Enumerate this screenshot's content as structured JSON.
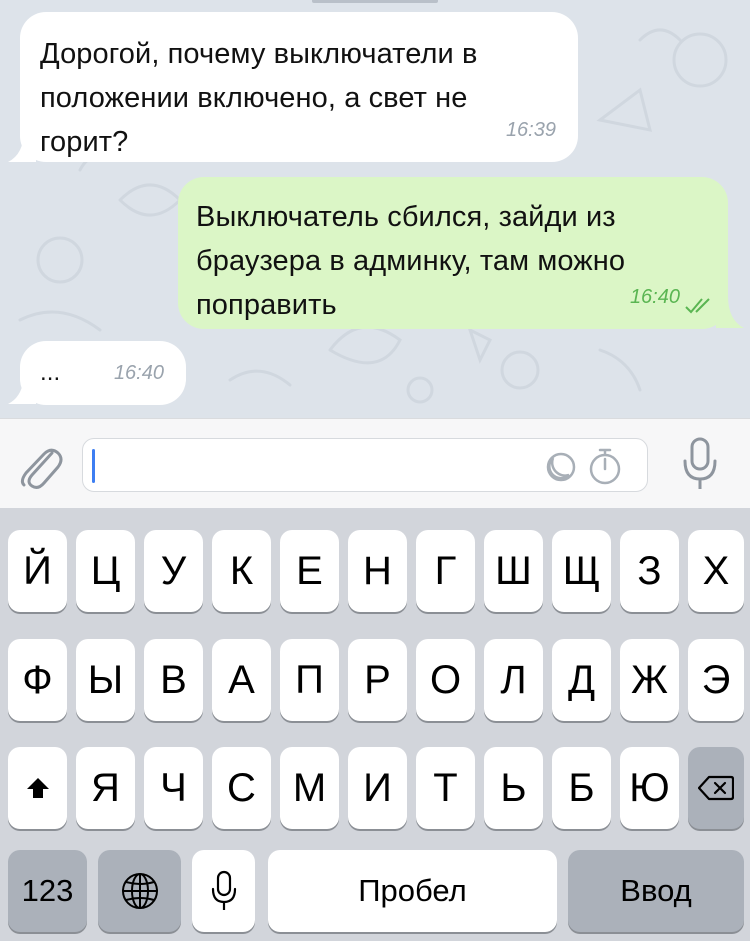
{
  "chat": {
    "messages": [
      {
        "direction": "incoming",
        "text": "Дорогой, почему выключатели в\nположении включено, а свет не\nгорит?",
        "time": "16:39"
      },
      {
        "direction": "outgoing",
        "text": "Выключатель сбился, зайди из\nбраузера в админку, там можно\nпоправить",
        "time": "16:40",
        "status": "read"
      },
      {
        "direction": "incoming",
        "text": "...",
        "time": "16:40"
      }
    ]
  },
  "input": {
    "value": "",
    "placeholder": ""
  },
  "icons": {
    "attach": "paperclip-icon",
    "stickers": "moon-icon",
    "timer": "stopwatch-icon",
    "voice": "microphone-icon",
    "shift": "shift-arrow-icon",
    "delete": "backspace-icon",
    "globe": "globe-icon",
    "dictation": "microphone-icon"
  },
  "colors": {
    "chat_background": "#dde3ea",
    "incoming_bubble": "#ffffff",
    "outgoing_bubble": "#dbf6c6",
    "outgoing_time": "#5ab552",
    "caret": "#3d7ef2"
  },
  "keyboard": {
    "row1": [
      "Й",
      "Ц",
      "У",
      "К",
      "Е",
      "Н",
      "Г",
      "Ш",
      "Щ",
      "З",
      "Х"
    ],
    "row2": [
      "Ф",
      "Ы",
      "В",
      "А",
      "П",
      "Р",
      "О",
      "Л",
      "Д",
      "Ж",
      "Э"
    ],
    "row3": [
      "Я",
      "Ч",
      "С",
      "М",
      "И",
      "Т",
      "Ь",
      "Б",
      "Ю"
    ],
    "numbers_label": "123",
    "space_label": "Пробел",
    "return_label": "Ввод"
  }
}
